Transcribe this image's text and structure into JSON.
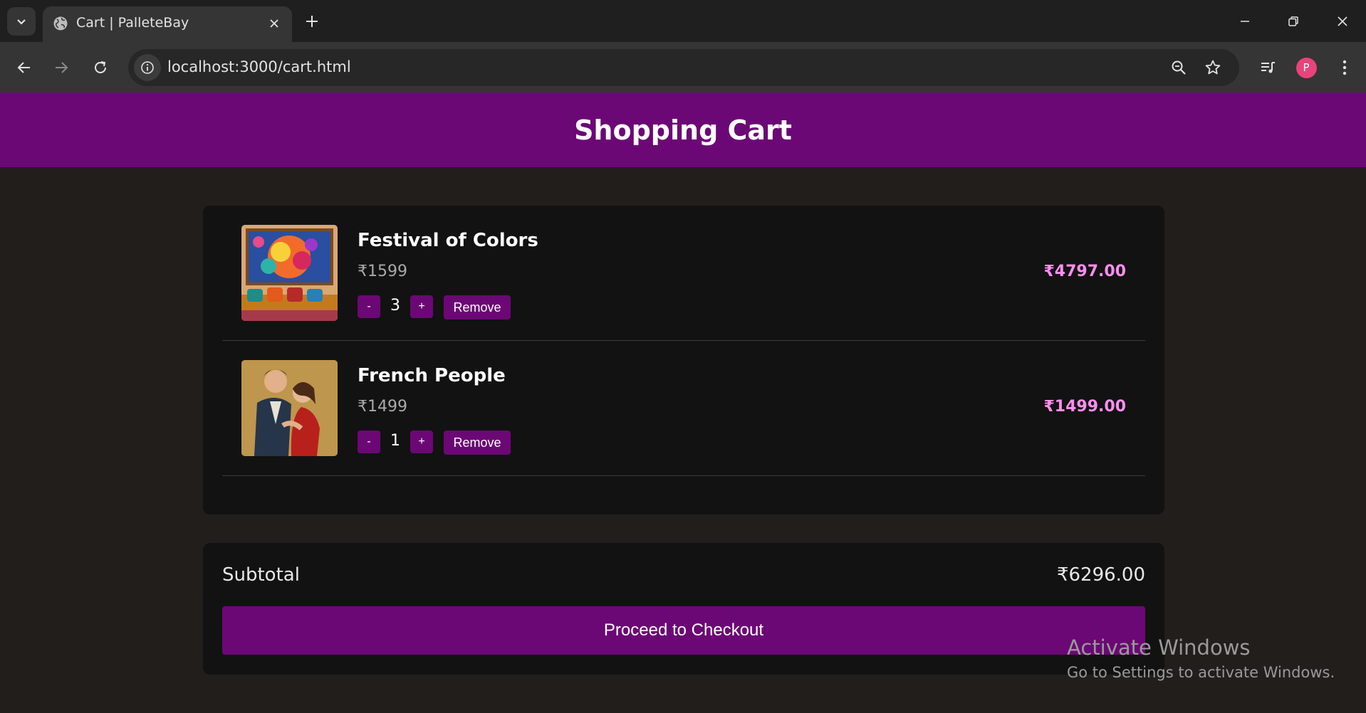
{
  "browser": {
    "tab_title": "Cart | PalleteBay",
    "url": "localhost:3000/cart.html",
    "profile_initial": "P",
    "profile_color": "#e8437a"
  },
  "page": {
    "title": "Shopping Cart",
    "accent_color": "#6c0875",
    "total_color": "#ff8ef0"
  },
  "cart": {
    "items": [
      {
        "name": "Festival of Colors",
        "price": "₹1599",
        "quantity": "3",
        "line_total": "₹4797.00",
        "decrement": "-",
        "increment": "+",
        "remove_label": "Remove"
      },
      {
        "name": "French People",
        "price": "₹1499",
        "quantity": "1",
        "line_total": "₹1499.00",
        "decrement": "-",
        "increment": "+",
        "remove_label": "Remove"
      }
    ]
  },
  "summary": {
    "subtotal_label": "Subtotal",
    "subtotal_value": "₹6296.00",
    "checkout_label": "Proceed to Checkout"
  },
  "watermark": {
    "title": "Activate Windows",
    "subtitle": "Go to Settings to activate Windows."
  }
}
